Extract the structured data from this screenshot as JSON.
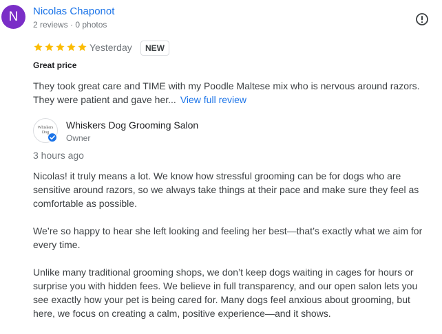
{
  "review": {
    "avatar_letter": "N",
    "avatar_color": "#7a2ec7",
    "reviewer_name": "Nicolas Chaponot",
    "reviewer_meta": "2 reviews · 0 photos",
    "rating": 5,
    "date": "Yesterday",
    "badge": "NEW",
    "title": "Great price",
    "text_lines": [
      "They took great care and TIME with my Poodle Maltese mix who is nervous around razors.",
      "They were patient and gave her..."
    ],
    "view_full_label": "View full review",
    "more_icon": "report-flag-icon"
  },
  "owner_reply": {
    "logo_text": "Whiskers Dog",
    "business_name": "Whiskers Dog Grooming Salon",
    "role": "Owner",
    "time": "3 hours ago",
    "paragraphs": [
      [
        "Nicolas! it truly means a lot. We know how stressful grooming can be for dogs who are",
        "sensitive around razors, so we always take things at their pace and make sure they feel as",
        "comfortable as possible."
      ],
      [
        "We’re so happy to hear she left looking and feeling her best—that’s exactly what we aim for",
        "every time."
      ],
      [
        "Unlike many traditional grooming shops, we don’t keep dogs waiting in cages for hours or",
        "surprise you with hidden fees. We believe in full transparency, and our open salon lets you",
        "see exactly how your pet is being cared for. Many dogs feel anxious about grooming, but",
        "here, we focus on creating a calm, positive experience—and it shows."
      ]
    ]
  },
  "colors": {
    "link": "#1a73e8",
    "star": "#fbbc04",
    "verified": "#1a73e8"
  }
}
